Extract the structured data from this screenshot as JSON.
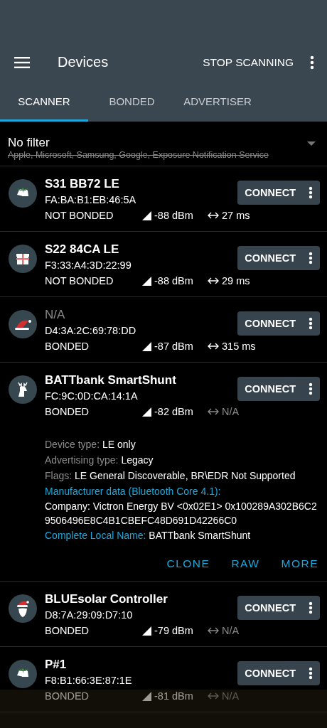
{
  "app_bar": {
    "title": "Devices",
    "action": "STOP SCANNING"
  },
  "tabs": [
    {
      "label": "SCANNER",
      "selected": true
    },
    {
      "label": "BONDED",
      "selected": false
    },
    {
      "label": "ADVERTISER",
      "selected": false
    }
  ],
  "filter": {
    "value": "No filter",
    "excluded": "Apple, Microsoft, Samsung, Google, Exposure Notification Service"
  },
  "devices": [
    {
      "kind": "bells",
      "name": "S31 BB72 LE",
      "name_known": true,
      "address": "FA:BA:B1:EB:46:5A",
      "bond": "NOT BONDED",
      "rssi": "-88 dBm",
      "interval": "27 ms",
      "interval_known": true,
      "button": "CONNECT"
    },
    {
      "kind": "gift",
      "name": "S22 84CA LE",
      "name_known": true,
      "address": "F3:33:A4:3D:22:99",
      "bond": "NOT BONDED",
      "rssi": "-88 dBm",
      "interval": "29 ms",
      "interval_known": true,
      "button": "CONNECT"
    },
    {
      "kind": "hat",
      "name": "N/A",
      "name_known": false,
      "address": "D4:3A:2C:69:78:DD",
      "bond": "BONDED",
      "rssi": "-87 dBm",
      "interval": "315 ms",
      "interval_known": true,
      "button": "CONNECT"
    },
    {
      "kind": "deer",
      "name": "BATTbank SmartShunt",
      "name_known": true,
      "address": "FC:9C:0D:CA:14:1A",
      "bond": "BONDED",
      "rssi": "-82 dBm",
      "interval": "N/A",
      "interval_known": false,
      "button": "CONNECT",
      "details": [
        {
          "kind": "field",
          "label": "Device type:",
          "value": "LE only"
        },
        {
          "kind": "field",
          "label": "Advertising type:",
          "value": "Legacy"
        },
        {
          "kind": "field",
          "label": "Flags:",
          "value": "LE General Discoverable, BR\\EDR Not Supported"
        },
        {
          "kind": "section",
          "label": "Manufacturer data (Bluetooth Core 4.1):"
        },
        {
          "kind": "value",
          "value": "Company: Victron Energy BV <0x02E1> 0x100289A302B6C29506496E8C4B1CBEFC48D691D42266C0"
        },
        {
          "kind": "section_field",
          "label": "Complete Local Name:",
          "value": "BATTbank SmartShunt"
        }
      ],
      "actions": [
        "CLONE",
        "RAW",
        "MORE"
      ]
    },
    {
      "kind": "santa",
      "name": "BLUEsolar Controller",
      "name_known": true,
      "address": "D8:7A:29:09:D7:10",
      "bond": "BONDED",
      "rssi": "-79 dBm",
      "interval": "N/A",
      "interval_known": false,
      "button": "CONNECT"
    },
    {
      "kind": "bells",
      "name": "P#1",
      "name_known": true,
      "address": "F8:B1:66:3E:87:1E",
      "bond": "BONDED",
      "rssi": "-81 dBm",
      "interval": "N/A",
      "interval_known": false,
      "button": "CONNECT"
    }
  ]
}
